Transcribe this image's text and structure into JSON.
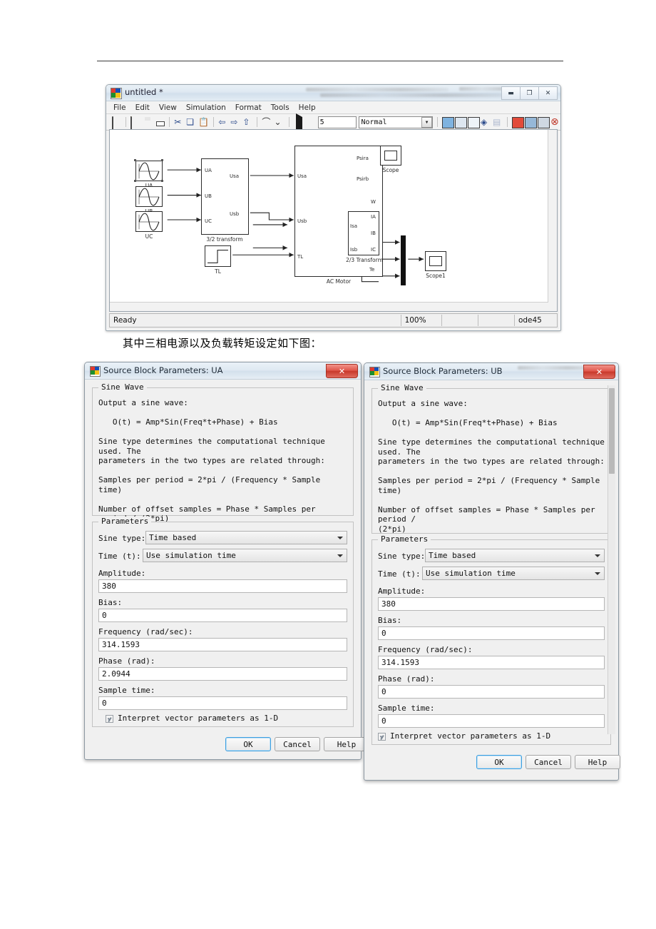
{
  "page": {
    "caption_cn": "其中三相电源以及负载转矩设定如下图："
  },
  "simulink_window": {
    "title": "untitled *",
    "icon": "simulink-icon",
    "window_buttons": [
      {
        "name": "minimize",
        "glyph": "▬"
      },
      {
        "name": "maximize",
        "glyph": "❐"
      },
      {
        "name": "close",
        "glyph": "✕"
      }
    ],
    "menu": [
      "File",
      "Edit",
      "View",
      "Simulation",
      "Format",
      "Tools",
      "Help"
    ],
    "toolbar": {
      "stop_time": "5",
      "sim_mode": "Normal",
      "icons": [
        "new-model-icon",
        "open-model-icon",
        "save-icon",
        "print-icon",
        "cut-icon",
        "copy-icon",
        "paste-icon",
        "undo-icon",
        "redo-icon",
        "up-to-parent-icon",
        "start-profiler-icon",
        "stop-profiler-icon",
        "start-simulation-icon",
        "stop-simulation-icon",
        "library-browser-icon",
        "model-explorer-icon",
        "update-diagram-icon",
        "debug-icon",
        "build-icon",
        "data-inspector-icon",
        "model-advisor-icon",
        "model-browser-icon",
        "block-help-icon"
      ]
    },
    "status_bar": {
      "ready": "Ready",
      "zoom": "100%",
      "cell3": "",
      "cell4": "",
      "solver": "ode45"
    },
    "diagram": {
      "sources": [
        {
          "name": "UA",
          "label": "UA",
          "selected": true
        },
        {
          "name": "UB",
          "label": "UB",
          "selected": false
        },
        {
          "name": "UC",
          "label": "UC",
          "selected": false
        }
      ],
      "step_block": {
        "label": "TL"
      },
      "transform32": {
        "label": "3/2 transform",
        "inputs": [
          "UA",
          "UB",
          "UC"
        ],
        "outputs": [
          "Usa",
          "Usb"
        ]
      },
      "ac_motor": {
        "label": "AC Motor",
        "inputs": [
          "Usa",
          "Usb",
          "TL"
        ],
        "outputs": [
          "Psira",
          "Psirb",
          "W",
          "Isa",
          "Isb",
          "Te"
        ]
      },
      "transform23": {
        "label": "2/3 Transform",
        "inputs": [
          "Isa",
          "Isb"
        ],
        "outputs": [
          "IA",
          "IB",
          "IC"
        ]
      },
      "scopes": [
        {
          "label": "Scope"
        },
        {
          "label": "Scope1"
        }
      ],
      "mux": {
        "label": ""
      }
    }
  },
  "dialog_ua": {
    "title": "Source Block Parameters: UA",
    "close_glyph": "✕",
    "group_label": "Sine Wave",
    "description": "Output a sine wave:\n\n   O(t) = Amp*Sin(Freq*t+Phase) + Bias\n\nSine type determines the computational technique used. The\nparameters in the two types are related through:\n\nSamples per period = 2*pi / (Frequency * Sample time)\n\nNumber of offset samples = Phase * Samples per period / (2*pi)\n\nUse the sample-based sine type if numerical problems due to\nrunning for large times (e.g. overflow in absolute time) occur.",
    "parameters_label": "Parameters",
    "fields": {
      "sine_type_label": "Sine type:",
      "sine_type_value": "Time based",
      "time_label": "Time (t):",
      "time_value": "Use simulation time",
      "amplitude_label": "Amplitude:",
      "amplitude_value": "380",
      "bias_label": "Bias:",
      "bias_value": "0",
      "frequency_label": "Frequency (rad/sec):",
      "frequency_value": "314.1593",
      "phase_label": "Phase (rad):",
      "phase_value": "2.0944",
      "sample_time_label": "Sample time:",
      "sample_time_value": "0",
      "interpret_label": "Interpret vector parameters as 1-D",
      "interpret_checked": true
    },
    "buttons": {
      "ok": "OK",
      "cancel": "Cancel",
      "help": "Help"
    }
  },
  "dialog_ub": {
    "title": "Source Block Parameters: UB",
    "close_glyph": "✕",
    "group_label": "Sine Wave",
    "description": "Output a sine wave:\n\n   O(t) = Amp*Sin(Freq*t+Phase) + Bias\n\nSine type determines the computational technique used. The\nparameters in the two types are related through:\n\nSamples per period = 2*pi / (Frequency * Sample time)\n\nNumber of offset samples = Phase * Samples per period /\n(2*pi)\n\nUse the sample-based sine type if numerical problems due\nto running for large times (e.g. overflow in absolute\ntime) occur.",
    "parameters_label": "Parameters",
    "fields": {
      "sine_type_label": "Sine type:",
      "sine_type_value": "Time based",
      "time_label": "Time (t):",
      "time_value": "Use simulation time",
      "amplitude_label": "Amplitude:",
      "amplitude_value": "380",
      "bias_label": "Bias:",
      "bias_value": "0",
      "frequency_label": "Frequency (rad/sec):",
      "frequency_value": "314.1593",
      "phase_label": "Phase (rad):",
      "phase_value": "0",
      "sample_time_label": "Sample time:",
      "sample_time_value": "0",
      "interpret_label": "Interpret vector parameters as 1-D",
      "interpret_checked": true
    },
    "buttons": {
      "ok": "OK",
      "cancel": "Cancel",
      "help": "Help"
    }
  }
}
